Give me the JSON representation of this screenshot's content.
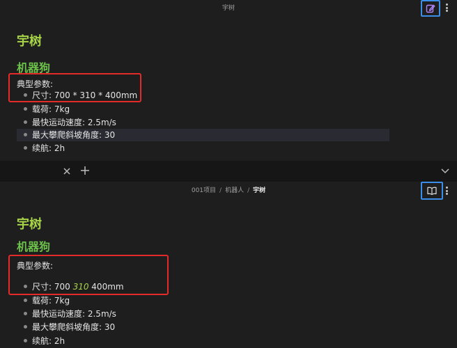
{
  "top_pane": {
    "title": "宇树",
    "heading1": "宇树",
    "heading2": "机器狗",
    "params_label": "典型参数:",
    "items": [
      "尺寸: 700 * 310 * 400mm",
      "载荷: 7kg",
      "最快运动速度: 2.5m/s",
      "最大攀爬斜坡角度: 30",
      "续航: 2h"
    ],
    "edit_icon": "pencil-square-icon",
    "more_icon": "vertical-dots-icon"
  },
  "bottom_pane": {
    "breadcrumb": [
      "001项目",
      "机器人",
      "宇树"
    ],
    "heading1": "宇树",
    "heading2": "机器狗",
    "params_label": "典型参数:",
    "size_item": {
      "prefix": "尺寸: 700 ",
      "italic": "310",
      "suffix": " 400mm"
    },
    "items": [
      "载荷: 7kg",
      "最快运动速度: 2.5m/s",
      "最大攀爬斜坡角度: 30",
      "续航: 2h"
    ],
    "reading_icon": "open-book-icon",
    "more_icon": "vertical-dots-icon"
  },
  "tabbar": {
    "close_icon": "close-icon",
    "new_tab_icon": "plus-icon",
    "menu_icon": "chevron-down-icon"
  },
  "colors": {
    "background": "#1e1e1e",
    "heading1": "#a8d448",
    "heading2": "#6cc14a",
    "highlight_box": "#e52a2a",
    "accent_blue": "#3b8fe8"
  }
}
